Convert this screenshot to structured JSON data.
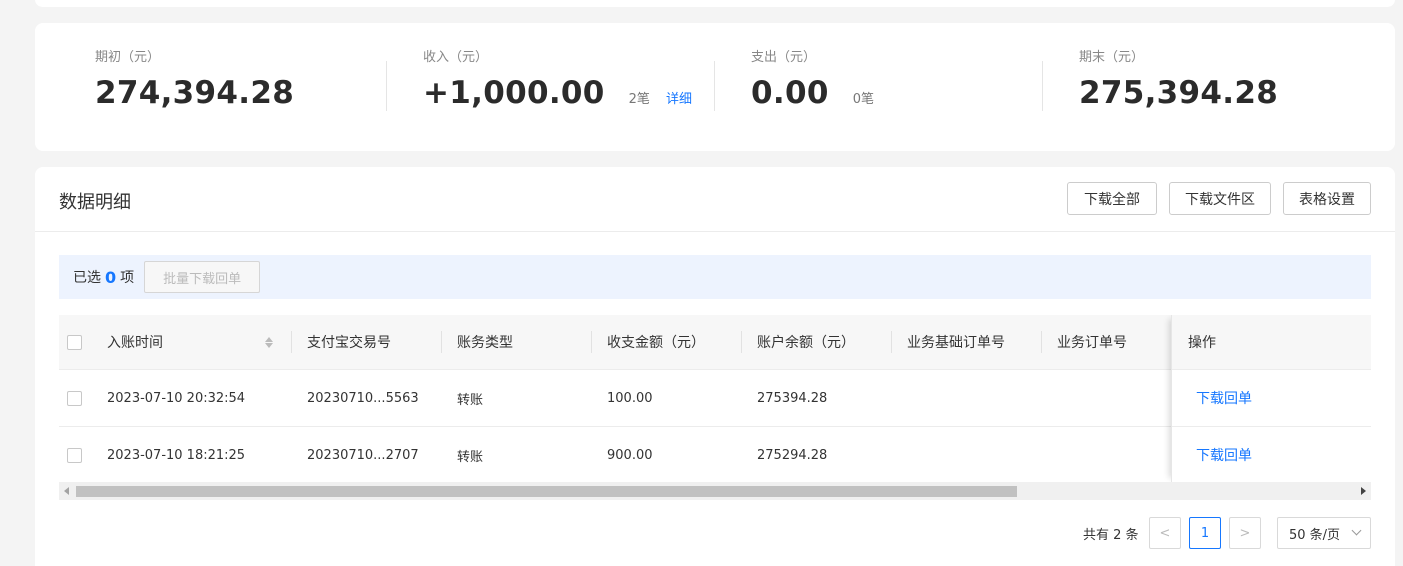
{
  "summary": {
    "opening": {
      "label": "期初（元）",
      "value": "274,394.28"
    },
    "income": {
      "label": "收入（元）",
      "value": "+1,000.00",
      "count": "2笔",
      "link": "详细"
    },
    "expense": {
      "label": "支出（元）",
      "value": "0.00",
      "count": "0笔"
    },
    "closing": {
      "label": "期末（元）",
      "value": "275,394.28"
    }
  },
  "detail": {
    "title": "数据明细",
    "buttons": {
      "download_all": "下载全部",
      "download_files": "下载文件区",
      "table_settings": "表格设置"
    }
  },
  "selection": {
    "prefix": "已选",
    "count": "0",
    "suffix": "项",
    "batch_button": "批量下载回单"
  },
  "table": {
    "headers": {
      "time": "入账时间",
      "alipay_no": "支付宝交易号",
      "type": "账务类型",
      "amount": "收支金额（元）",
      "balance": "账户余额（元）",
      "base_order": "业务基础订单号",
      "order": "业务订单号",
      "action": "操作"
    },
    "rows": [
      {
        "time": "2023-07-10 20:32:54",
        "alipay_no": "20230710...5563",
        "type": "转账",
        "amount": "100.00",
        "balance": "275394.28",
        "base_order": "",
        "order": "",
        "action": "下载回单"
      },
      {
        "time": "2023-07-10 18:21:25",
        "alipay_no": "20230710...2707",
        "type": "转账",
        "amount": "900.00",
        "balance": "275294.28",
        "base_order": "",
        "order": "",
        "action": "下载回单"
      }
    ]
  },
  "pagination": {
    "total": "共有 2 条",
    "current_page": "1",
    "prev": "<",
    "next": ">",
    "page_size": "50 条/页"
  },
  "colors": {
    "accent": "#1677ff",
    "selection_bg": "#edf3fe",
    "page_bg": "#f4f4f4"
  }
}
